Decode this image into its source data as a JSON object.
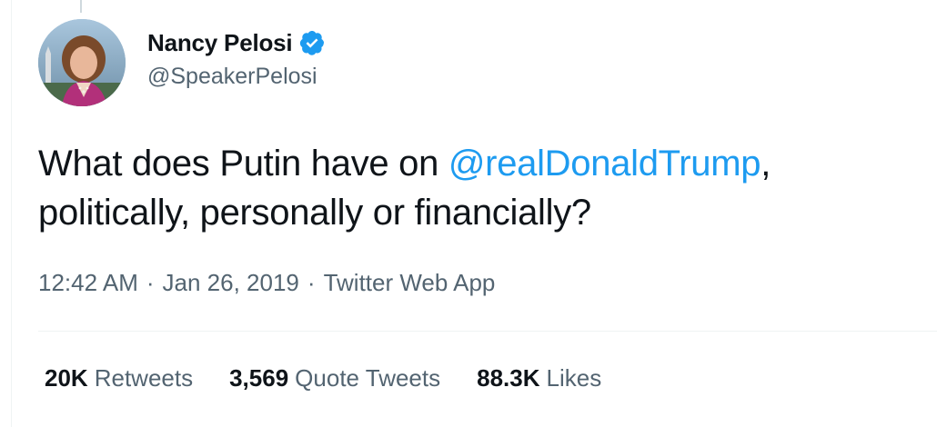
{
  "author": {
    "display_name": "Nancy Pelosi",
    "handle": "@SpeakerPelosi",
    "verified": true,
    "avatar_icon": "profile-photo"
  },
  "tweet": {
    "text_before": "What does Putin have on ",
    "mention": "@realDonaldTrump",
    "text_after": ", politically, personally or financially?"
  },
  "meta": {
    "time": "12:42 AM",
    "separator": "·",
    "date": "Jan 26, 2019",
    "source": "Twitter Web App"
  },
  "stats": [
    {
      "value": "20K",
      "label": "Retweets"
    },
    {
      "value": "3,569",
      "label": "Quote Tweets"
    },
    {
      "value": "88.3K",
      "label": "Likes"
    }
  ],
  "colors": {
    "text": "#0f1419",
    "secondary": "#536471",
    "link": "#1d9bf0",
    "verified": "#1d9bf0",
    "divider": "#eff3f4"
  }
}
